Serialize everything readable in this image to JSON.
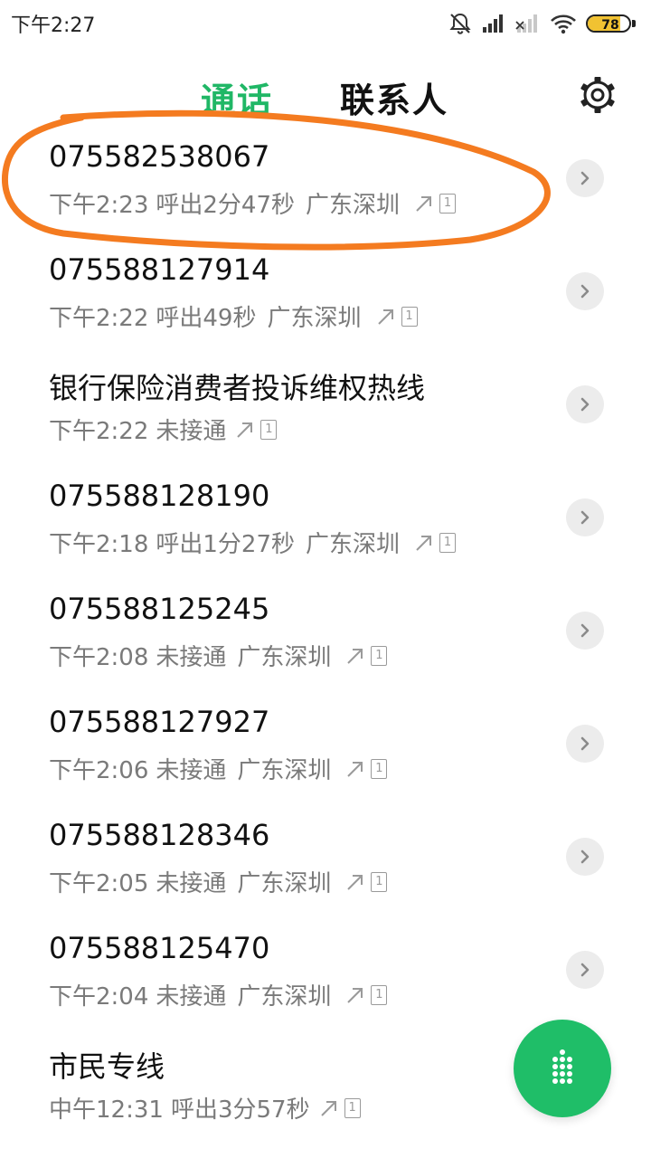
{
  "status_bar": {
    "time": "下午2:27",
    "battery": "78",
    "battery_level_pct": 78,
    "icons": [
      "mute-icon",
      "signal-icon",
      "signal-empty-icon",
      "wifi-icon",
      "battery-icon"
    ]
  },
  "header": {
    "tab_calls": "通话",
    "tab_contacts": "联系人",
    "settings_icon": "gear-icon"
  },
  "colors": {
    "accent": "#20b766",
    "annotation": "#f47b20"
  },
  "calls": [
    {
      "name": "075582538067",
      "time": "下午2:23",
      "status": "呼出2分47秒",
      "location": "广东深圳"
    },
    {
      "name": "075588127914",
      "time": "下午2:22",
      "status": "呼出49秒",
      "location": "广东深圳"
    },
    {
      "name": "银行保险消费者投诉维权热线",
      "time": "下午2:22",
      "status": "未接通",
      "location": ""
    },
    {
      "name": "075588128190",
      "time": "下午2:18",
      "status": "呼出1分27秒",
      "location": "广东深圳"
    },
    {
      "name": "075588125245",
      "time": "下午2:08",
      "status": "未接通",
      "location": "广东深圳"
    },
    {
      "name": "075588127927",
      "time": "下午2:06",
      "status": "未接通",
      "location": "广东深圳"
    },
    {
      "name": "075588128346",
      "time": "下午2:05",
      "status": "未接通",
      "location": "广东深圳"
    },
    {
      "name": "075588125470",
      "time": "下午2:04",
      "status": "未接通",
      "location": "广东深圳"
    },
    {
      "name": "市民专线",
      "time": "中午12:31",
      "status": "呼出3分57秒",
      "location": ""
    }
  ],
  "sim_label": "1",
  "fab_icon": "dialpad-icon"
}
